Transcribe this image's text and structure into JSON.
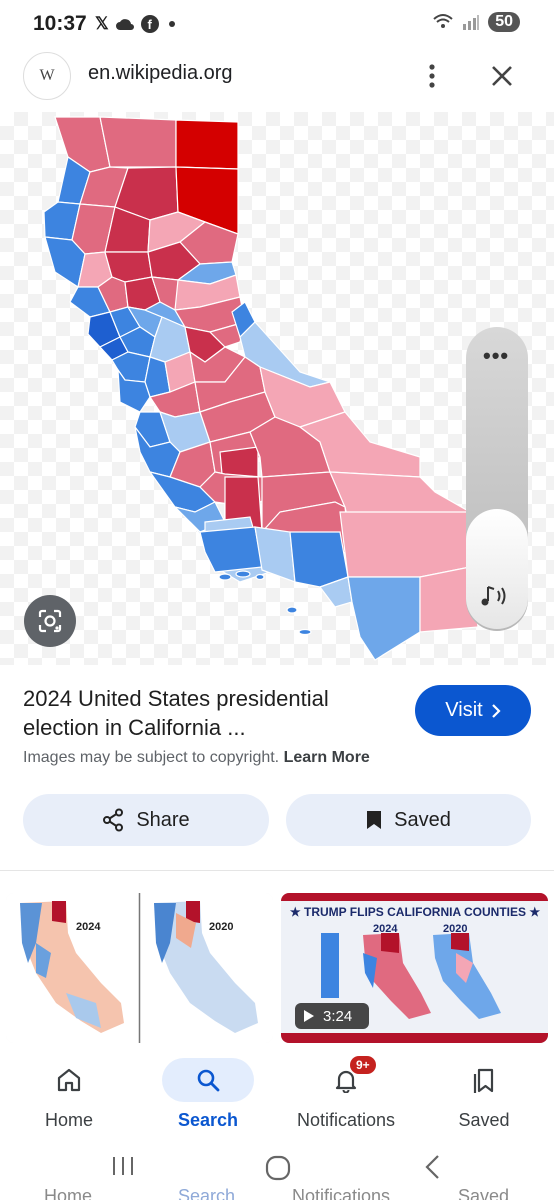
{
  "status_bar": {
    "time": "10:37",
    "notification_icons": [
      "x-icon",
      "cloud-icon",
      "facebook-icon",
      "dot-icon"
    ],
    "battery": "50"
  },
  "header": {
    "favicon_letter": "W",
    "url": "en.wikipedia.org"
  },
  "colors": {
    "dark_red": "#d40000",
    "red": "#c9304c",
    "medium_red": "#e06a80",
    "light_red": "#f4a6b5",
    "pale_red": "#f8c3cd",
    "dark_blue": "#1e5fd0",
    "blue": "#3d84e0",
    "medium_blue": "#6ea7ea",
    "light_blue": "#a9cbf2",
    "accent": "#0b57d0"
  },
  "result": {
    "title": "2024 United States presidential election in California ...",
    "visit_label": "Visit",
    "copyright_text": "Images may be subject to copyright.",
    "learn_more": "Learn More",
    "share_label": "Share",
    "saved_label": "Saved"
  },
  "related": {
    "thumb1_labels": [
      "2024",
      "2020"
    ],
    "thumb2_headline": "★ TRUMP FLIPS CALIFORNIA COUNTIES ★",
    "thumb2_years": [
      "2024",
      "2020"
    ],
    "video_duration": "3:24"
  },
  "bottom_nav": {
    "items": [
      {
        "label": "Home",
        "icon": "home-icon"
      },
      {
        "label": "Search",
        "icon": "search-icon"
      },
      {
        "label": "Notifications",
        "icon": "bell-icon"
      },
      {
        "label": "Saved",
        "icon": "bookmarks-icon"
      }
    ],
    "notification_badge": "9+"
  }
}
